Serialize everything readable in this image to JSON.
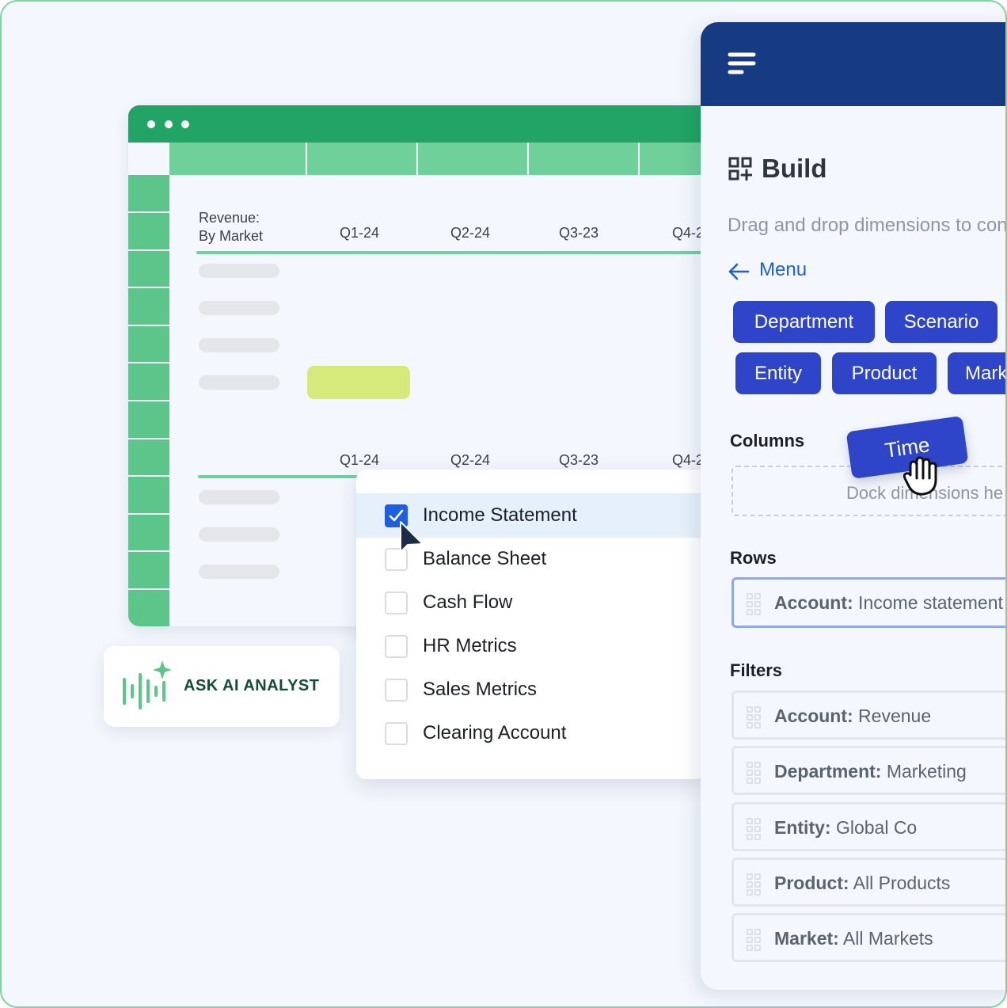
{
  "sheet": {
    "title_line1": "Revenue:",
    "title_line2": "By Market",
    "quarters_top": [
      "Q1-24",
      "Q2-24",
      "Q3-23",
      "Q4-2"
    ],
    "quarters_bottom": [
      "Q1-24",
      "Q2-24",
      "Q3-23",
      "Q4-2"
    ]
  },
  "ask_ai": {
    "label": "ASK AI ANALYST",
    "icon": "voice-sparkle-icon"
  },
  "statements": {
    "items": [
      {
        "label": "Income Statement",
        "checked": true
      },
      {
        "label": "Balance Sheet",
        "checked": false
      },
      {
        "label": "Cash Flow",
        "checked": false
      },
      {
        "label": "HR Metrics",
        "checked": false
      },
      {
        "label": "Sales Metrics",
        "checked": false
      },
      {
        "label": "Clearing Account",
        "checked": false
      }
    ]
  },
  "panel": {
    "title": "Build",
    "subtitle": "Drag and drop dimensions to con",
    "back_label": "Menu",
    "dimensions": [
      "Department",
      "Scenario",
      "Entity",
      "Product",
      "Mark"
    ],
    "columns_label": "Columns",
    "dragging_chip": "Time",
    "dock_placeholder": "Dock dimensions he",
    "rows_label": "Rows",
    "rows": [
      {
        "key": "Account:",
        "value": " Income statement"
      }
    ],
    "filters_label": "Filters",
    "filters": [
      {
        "key": "Account:",
        "value": " Revenue"
      },
      {
        "key": "Department:",
        "value": " Marketing"
      },
      {
        "key": "Entity:",
        "value": " Global Co"
      },
      {
        "key": "Product:",
        "value": " All Products"
      },
      {
        "key": "Market:",
        "value": " All Markets"
      }
    ]
  },
  "colors": {
    "sheet_header": "#21a465",
    "sheet_columns": "#6fd09a",
    "panel_header": "#173b82",
    "chip": "#2f45c9",
    "link": "#1d5fe0"
  }
}
